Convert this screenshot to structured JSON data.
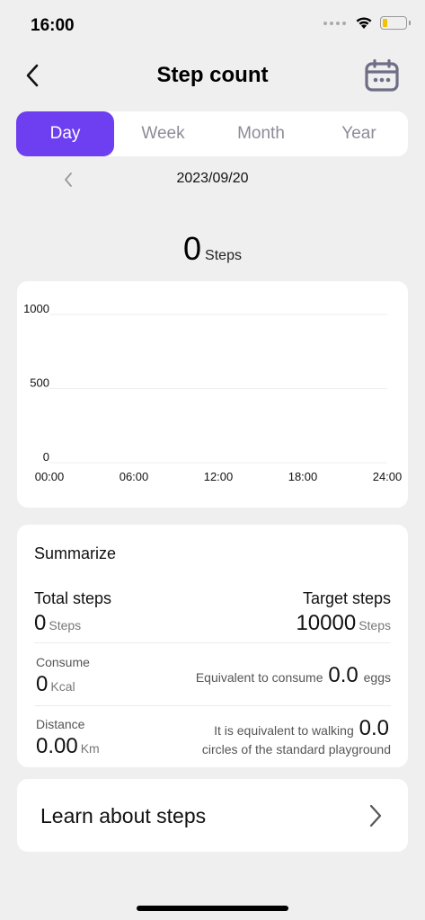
{
  "status_bar": {
    "time": "16:00"
  },
  "header": {
    "title": "Step count",
    "back_icon": "chevron-left-icon",
    "calendar_icon": "calendar-icon"
  },
  "tabs": [
    {
      "label": "Day",
      "active": true
    },
    {
      "label": "Week",
      "active": false
    },
    {
      "label": "Month",
      "active": false
    },
    {
      "label": "Year",
      "active": false
    }
  ],
  "date": {
    "label": "2023/09/20"
  },
  "steps": {
    "value": "0",
    "unit": "Steps"
  },
  "chart_data": {
    "type": "bar",
    "categories": [
      "00:00",
      "06:00",
      "12:00",
      "18:00",
      "24:00"
    ],
    "values": [
      0,
      0,
      0,
      0,
      0
    ],
    "y_ticks": [
      "1000",
      "500",
      "0"
    ],
    "x_ticks": [
      "00:00",
      "06:00",
      "12:00",
      "18:00",
      "24:00"
    ],
    "ylim": [
      0,
      1000
    ],
    "grid": true
  },
  "summary": {
    "title": "Summarize",
    "total_steps_label": "Total steps",
    "total_steps_value": "0",
    "total_steps_unit": "Steps",
    "target_steps_label": "Target steps",
    "target_steps_value": "10000",
    "target_steps_unit": "Steps",
    "consume_label": "Consume",
    "consume_value": "0",
    "consume_unit": "Kcal",
    "equivalent_prefix": "Equivalent to consume",
    "eggs_value": "0.0",
    "eggs_unit": "eggs",
    "distance_label": "Distance",
    "distance_value": "0.00",
    "distance_unit": "Km",
    "walking_prefix": "It is equivalent to walking",
    "walking_value": "0.0",
    "walking_suffix": "circles of the standard playground"
  },
  "learn": {
    "label": "Learn about steps",
    "icon": "chevron-right-icon"
  },
  "colors": {
    "accent": "#6d3ff0",
    "background": "#efefef",
    "card": "#ffffff"
  }
}
